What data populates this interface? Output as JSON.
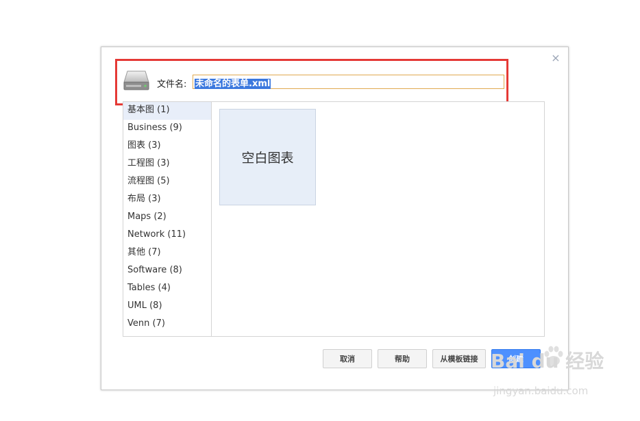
{
  "dialog": {
    "close_glyph": "×",
    "filename_label": "文件名:",
    "filename_value": "未命名的表单.xml",
    "categories": [
      {
        "label": "基本图 (1)",
        "active": true
      },
      {
        "label": "Business (9)"
      },
      {
        "label": "图表 (3)"
      },
      {
        "label": "工程图 (3)"
      },
      {
        "label": "流程图 (5)"
      },
      {
        "label": "布局 (3)"
      },
      {
        "label": "Maps (2)"
      },
      {
        "label": "Network (11)"
      },
      {
        "label": "其他 (7)"
      },
      {
        "label": "Software (8)"
      },
      {
        "label": "Tables (4)"
      },
      {
        "label": "UML (8)"
      },
      {
        "label": "Venn (7)"
      }
    ],
    "template_tile": "空白图表",
    "buttons": {
      "cancel": "取消",
      "help": "帮助",
      "from_template_link": "从模板链接",
      "create": "创建"
    }
  },
  "watermark": {
    "brand": "Bai du 经验",
    "url": "jingyan.baidu.com"
  },
  "icons": {
    "drive": "hard-drive-icon",
    "close": "close-icon"
  },
  "colors": {
    "primary_button": "#4d90fe",
    "selection": "#3b78de",
    "annotation": "#e53935",
    "input_border": "#e0a94f"
  }
}
